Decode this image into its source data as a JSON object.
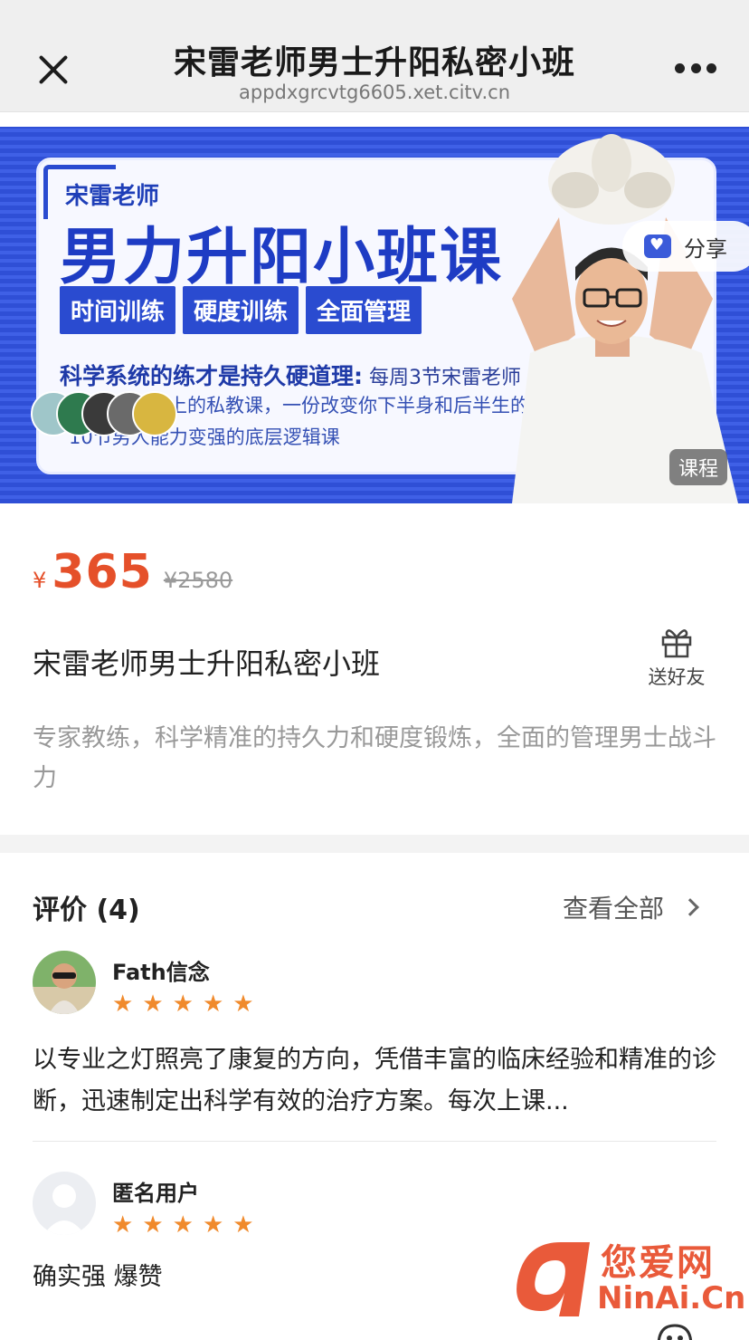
{
  "header": {
    "title": "宋雷老师男士升阳私密小班",
    "url": "appdxgrcvtg6605.xet.citv.cn"
  },
  "banner": {
    "teacher": "宋雷老师",
    "headline": "男力升阳小班课",
    "tags": [
      "时间训练",
      "硬度训练",
      "全面管理"
    ],
    "line1_bold": "科学系统的练才是持久硬道理:",
    "line1_rest": "每周3节宋雷老师",
    "line2": "上的私教课，一份改变你下半身和后半生的",
    "line3": "10节男人能力变强的底层逻辑课",
    "share_label": "分享",
    "badge": "课程"
  },
  "product": {
    "currency": "¥",
    "price": "365",
    "original_price": "¥2580",
    "title": "宋雷老师男士升阳私密小班",
    "gift_label": "送好友",
    "description": "专家教练，科学精准的持久力和硬度锻炼，全面的管理男士战斗力"
  },
  "reviews": {
    "title": "评价 (4)",
    "view_all": "查看全部",
    "items": [
      {
        "name": "Fath信念",
        "stars": 5,
        "text": "以专业之灯照亮了康复的方向，凭借丰富的临床经验和精准的诊断，迅速制定出科学有效的治疗方案。每次上课..."
      },
      {
        "name": "匿名用户",
        "stars": 5,
        "text": "确实强 爆赞"
      }
    ]
  },
  "watermark": {
    "cn": "您爱网",
    "en": "NinAi.Cn"
  },
  "colors": {
    "price": "#e5502a",
    "star": "#f08a2c",
    "banner_blue": "#2f4fd6"
  }
}
